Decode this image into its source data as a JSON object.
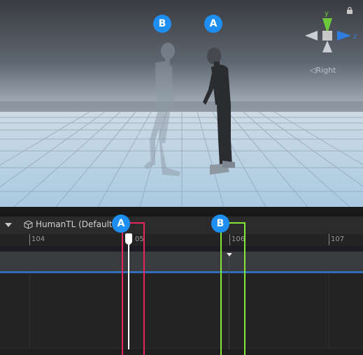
{
  "scene": {
    "badge_b": "B",
    "badge_a": "A",
    "gizmo": {
      "y_label": "y",
      "z_label": "z",
      "perspective_label": "◁Right"
    },
    "colors": {
      "sky_top": "#3a3b40",
      "horizon": "#aeb9c3",
      "floor": "#b8d3e6",
      "gizmo_y": "#6ec93a",
      "gizmo_z": "#2f7de0"
    }
  },
  "timeline": {
    "asset_label": "HumanTL (DefaultM",
    "asset_icon": "cube-icon",
    "ticks": [
      "104",
      "05",
      "106",
      "107"
    ],
    "badge_a": "A",
    "badge_b": "B",
    "colors": {
      "playhead": "#ffffff",
      "box_a": "#e8245e",
      "box_b": "#86e836",
      "badge": "#1e8ef0",
      "track_line": "#2f6fb8"
    }
  }
}
